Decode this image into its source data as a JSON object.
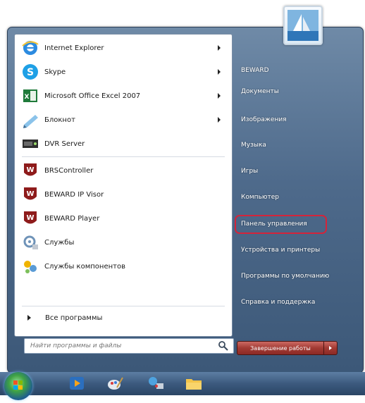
{
  "programs": [
    {
      "label": "Internet Explorer",
      "icon": "internet-explorer-icon",
      "has_arrow": true
    },
    {
      "label": "Skype",
      "icon": "skype-icon",
      "has_arrow": true
    },
    {
      "label": "Microsoft Office Excel 2007",
      "icon": "excel-icon",
      "has_arrow": true
    },
    {
      "label": "Блокнот",
      "icon": "notepad-icon",
      "has_arrow": true
    },
    {
      "label": "DVR Server",
      "icon": "dvr-server-icon",
      "has_arrow": false
    },
    {
      "label": "BRSController",
      "icon": "beward-icon",
      "has_arrow": false
    },
    {
      "label": "BEWARD IP Visor",
      "icon": "beward-icon",
      "has_arrow": false
    },
    {
      "label": "BEWARD Player",
      "icon": "beward-icon",
      "has_arrow": false
    },
    {
      "label": "Службы",
      "icon": "services-icon",
      "has_arrow": false
    },
    {
      "label": "Службы компонентов",
      "icon": "component-services-icon",
      "has_arrow": false
    }
  ],
  "all_programs_label": "Все программы",
  "search_placeholder": "Найти программы и файлы",
  "right_items": [
    "BEWARD",
    "Документы",
    "Изображения",
    "Музыка",
    "Игры",
    "Компьютер",
    "Панель управления",
    "Устройства и принтеры",
    "Программы по умолчанию",
    "Справка и поддержка"
  ],
  "highlighted_item": "Панель управления",
  "shutdown_label": "Завершение работы",
  "colors": {
    "highlight": "#d4243a",
    "menu_frame": "#4e6a8b",
    "beward_red": "#8e1b1b"
  },
  "taskbar_icons": [
    "start-orb",
    "media-player-icon",
    "paint-icon",
    "network-icon",
    "folder-icon"
  ]
}
